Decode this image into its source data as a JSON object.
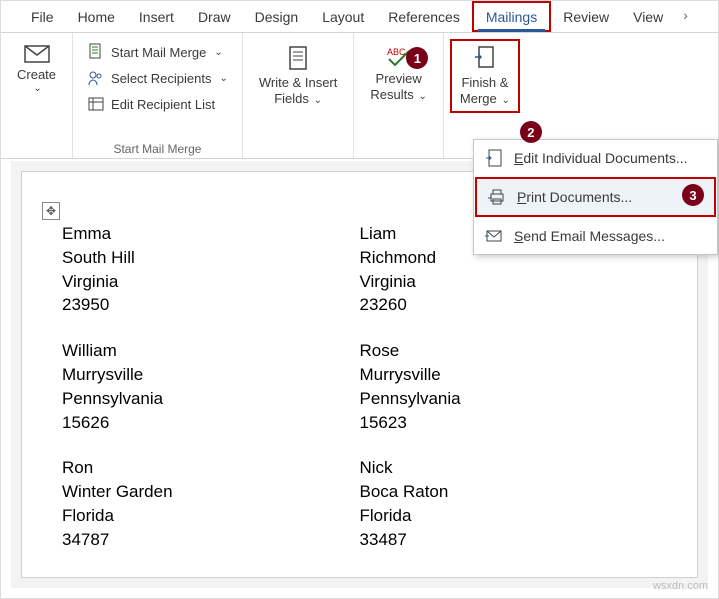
{
  "tabs": {
    "file": "File",
    "home": "Home",
    "insert": "Insert",
    "draw": "Draw",
    "design": "Design",
    "layout": "Layout",
    "references": "References",
    "mailings": "Mailings",
    "review": "Review",
    "view": "View",
    "more": "›"
  },
  "ribbon": {
    "create": {
      "label": "Create"
    },
    "startGroup": {
      "label": "Start Mail Merge",
      "startMailMerge": "Start Mail Merge",
      "selectRecipients": "Select Recipients",
      "editRecipientList": "Edit Recipient List"
    },
    "writeInsert": {
      "label1": "Write & Insert",
      "label2": "Fields"
    },
    "preview": {
      "label1": "Preview",
      "label2": "Results"
    },
    "finish": {
      "label1": "Finish &",
      "label2": "Merge"
    }
  },
  "menu": {
    "editIndividual": "Edit Individual Documents...",
    "printDocs": "Print Documents...",
    "sendEmail": "Send Email Messages..."
  },
  "badges": {
    "b1": "1",
    "b2": "2",
    "b3": "3"
  },
  "labelsLeft": [
    {
      "name": "Emma",
      "city": "South Hill",
      "state": "Virginia",
      "zip": "23950"
    },
    {
      "name": "William",
      "city": "Murrysville",
      "state": "Pennsylvania",
      "zip": "15626"
    },
    {
      "name": "Ron",
      "city": "Winter Garden",
      "state": "Florida",
      "zip": "34787"
    }
  ],
  "labelsRight": [
    {
      "name": "Liam",
      "city": "Richmond",
      "state": "Virginia",
      "zip": "23260"
    },
    {
      "name": "Rose",
      "city": "Murrysville",
      "state": "Pennsylvania",
      "zip": "15623"
    },
    {
      "name": "Nick",
      "city": "Boca Raton",
      "state": "Florida",
      "zip": "33487"
    }
  ],
  "watermark": "wsxdn.com"
}
